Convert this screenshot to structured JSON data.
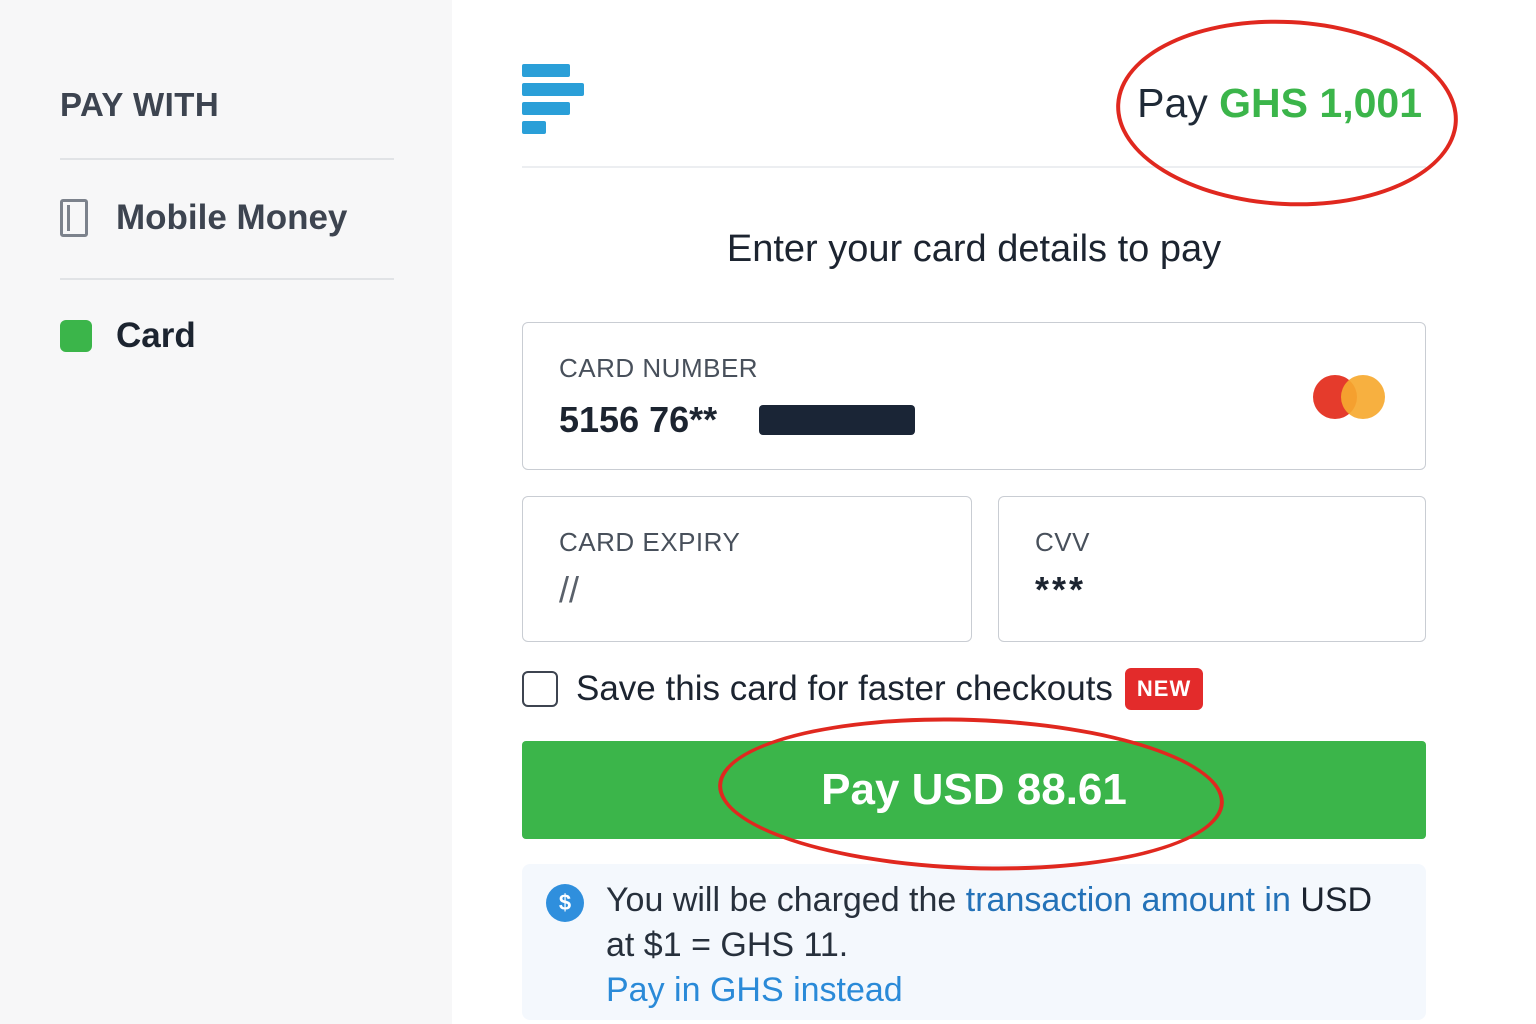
{
  "sidebar": {
    "heading": "PAY WITH",
    "items": [
      {
        "label": "Mobile Money",
        "icon": "phone-icon",
        "selected": false
      },
      {
        "label": "Card",
        "icon": "card-indicator-icon",
        "selected": true
      }
    ]
  },
  "header": {
    "pay_prefix": "Pay",
    "pay_amount": "GHS 1,001"
  },
  "main": {
    "instruction": "Enter your card details to pay",
    "card_number": {
      "label": "CARD NUMBER",
      "value": "5156 76**"
    },
    "card_expiry": {
      "label": "CARD EXPIRY",
      "value": "//"
    },
    "cvv": {
      "label": "CVV",
      "value": "***"
    },
    "save_card": {
      "label": "Save this card for faster checkouts",
      "badge": "NEW",
      "checked": false
    },
    "pay_button": "Pay USD 88.61",
    "info": {
      "text_1": "You will be charged the ",
      "text_2": "transaction amount in ",
      "text_3": "USD",
      "text_4": " at $1 = GHS 11.",
      "link": "Pay in GHS instead",
      "icon_glyph": "$"
    }
  },
  "colors": {
    "accent_green": "#3bb54a",
    "brand_blue": "#2a9fd8",
    "annotation_red": "#e0281f",
    "badge_red": "#e32b2b"
  }
}
